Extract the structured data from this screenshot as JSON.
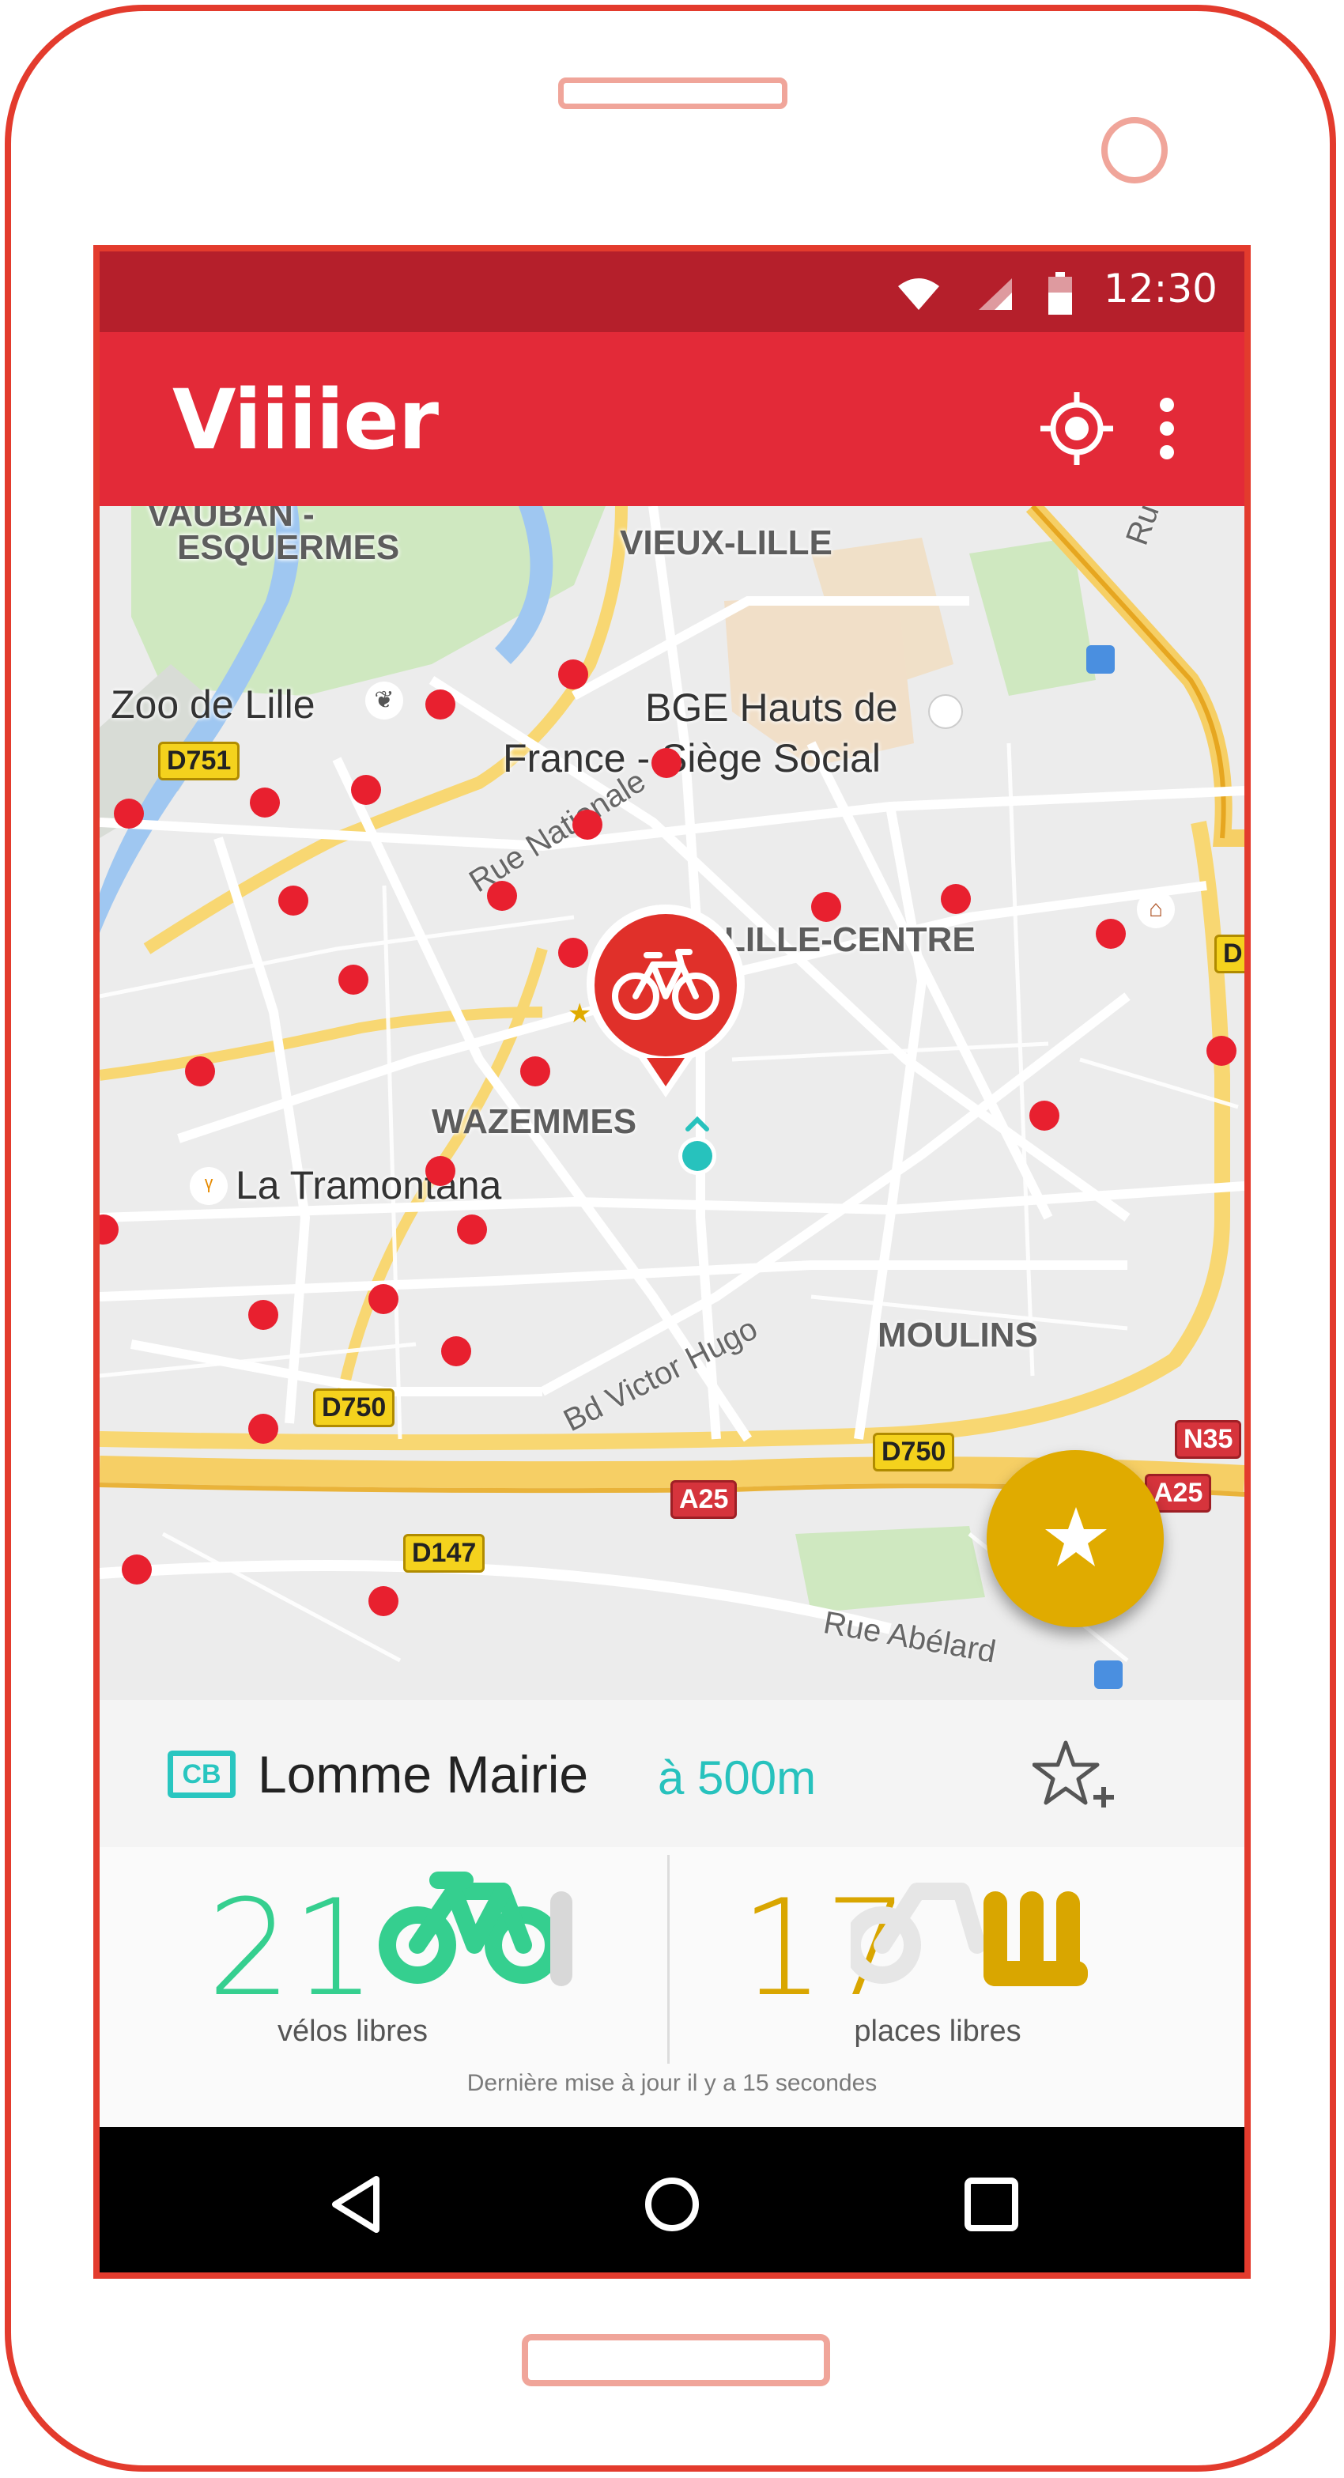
{
  "status": {
    "time": "12:30"
  },
  "app": {
    "title": "Viiiier"
  },
  "map": {
    "labels": {
      "vauban": "VAUBAN -",
      "esquermes": "ESQUERMES",
      "vieux_lille": "VIEUX-LILLE",
      "zoo": "Zoo de Lille",
      "bge_line1": "BGE Hauts de",
      "bge_line2": "France - Siège Social",
      "lille_centre": "LILLE-CENTRE",
      "wazemmes": "WAZEMMES",
      "tramontana": "La Tramontana",
      "moulins": "MOULINS"
    },
    "roads": {
      "rue_nationale": "Rue Nationale",
      "bd_victor_hugo": "Bd Victor Hugo",
      "rue_abelard": "Rue Abélard",
      "rue_cut": "Ru"
    },
    "shields": {
      "d751": "D751",
      "d750_a": "D750",
      "d750_b": "D750",
      "d147": "D147",
      "a25_a": "A25",
      "a25_b": "A25",
      "n35": "N35",
      "d_cut": "D"
    }
  },
  "station": {
    "badge": "CB",
    "name": "Lomme Mairie",
    "distance": "à 500m",
    "bikes_count": "21",
    "bikes_label": "vélos libres",
    "places_count": "17",
    "places_label": "places libres",
    "updated": "Dernière mise à jour il y a 15 secondes"
  },
  "colors": {
    "brand": "#e32a38",
    "status_bar": "#b51f2b",
    "bikes": "#35cf8f",
    "places": "#d9a600",
    "distance": "#27c2bd",
    "fab": "#e0ab00"
  },
  "icons": {
    "wifi": "wifi-icon",
    "signal": "signal-icon",
    "battery": "battery-icon",
    "locate": "locate-icon",
    "menu": "more-vert-icon",
    "favorite_fab": "star-icon",
    "add_favorite": "star-add-icon",
    "back": "back-icon",
    "home": "home-icon",
    "recents": "recents-icon"
  }
}
